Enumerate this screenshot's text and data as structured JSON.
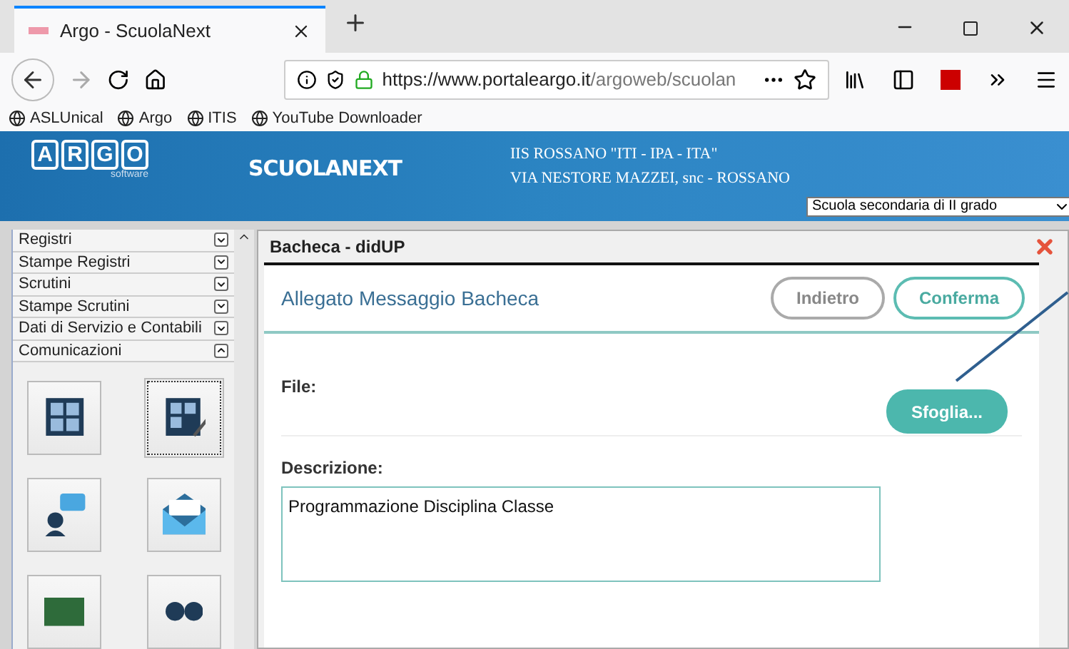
{
  "browser": {
    "tab_title": "Argo - ScuolaNext",
    "url_host": "https://www.portaleargo.it",
    "url_path": "/argoweb/scuolan",
    "bookmarks": [
      "ASLUnical",
      "Argo",
      "ITIS",
      "YouTube Downloader"
    ]
  },
  "header": {
    "logo": [
      "A",
      "R",
      "G",
      "O"
    ],
    "logo_sub": "software",
    "product": "SCUOLANEXT",
    "school_line_1": "IIS ROSSANO \"ITI - IPA - ITA\"",
    "school_line_2": "VIA NESTORE MAZZEI, snc - ROSSANO",
    "school_type": "Scuola secondaria di II grado"
  },
  "sidebar": {
    "sections": [
      {
        "label": "Registri",
        "expanded": false
      },
      {
        "label": "Stampe Registri",
        "expanded": false
      },
      {
        "label": "Scrutini",
        "expanded": false
      },
      {
        "label": "Stampe Scrutini",
        "expanded": false
      },
      {
        "label": "Dati di Servizio e Contabili",
        "expanded": false
      },
      {
        "label": "Comunicazioni",
        "expanded": true
      }
    ],
    "tiles": [
      {
        "kind": "board",
        "selected": false
      },
      {
        "kind": "board-edit",
        "selected": true
      },
      {
        "kind": "chat",
        "selected": false
      },
      {
        "kind": "mail",
        "selected": false
      },
      {
        "kind": "slate",
        "selected": false
      },
      {
        "kind": "people",
        "selected": false
      }
    ]
  },
  "panel": {
    "title": "Bacheca - didUP",
    "heading": "Allegato Messaggio Bacheca",
    "buttons": [
      {
        "label": "Indietro",
        "kind": "secondary"
      },
      {
        "label": "Conferma",
        "kind": "primary"
      }
    ],
    "file_label": "File:",
    "browse_button": "Sfoglia...",
    "description_label": "Descrizione:",
    "description_value": "Programmazione Disciplina Classe"
  }
}
